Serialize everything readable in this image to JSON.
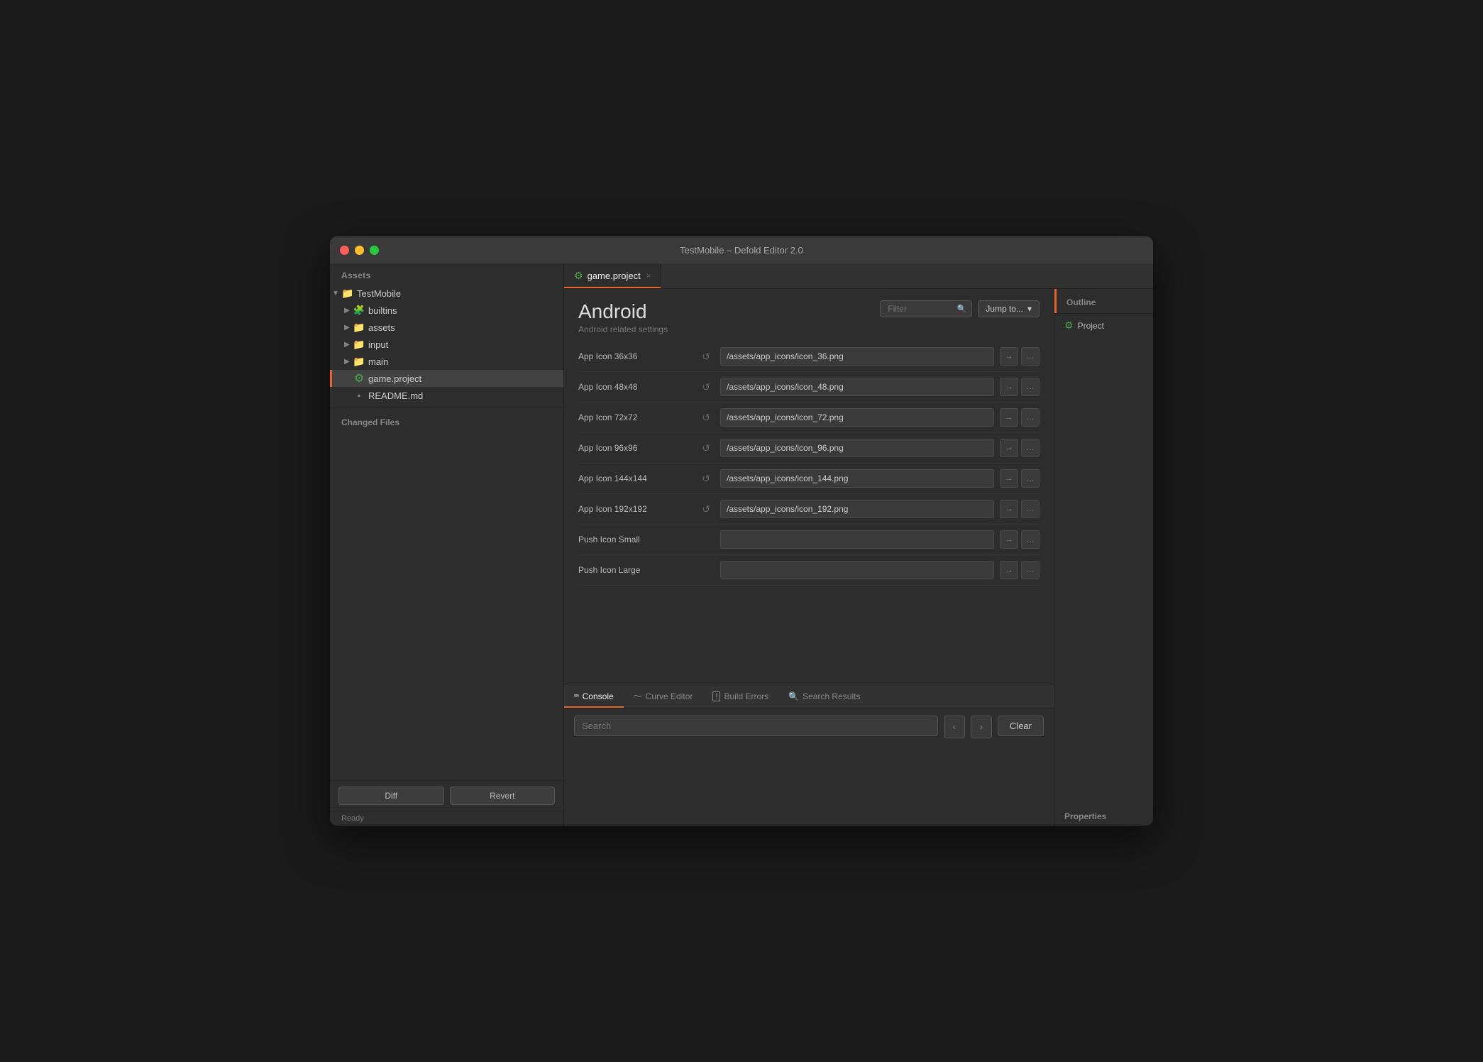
{
  "window": {
    "title": "TestMobile – Defold Editor 2.0"
  },
  "titlebar": {
    "title": "TestMobile – Defold Editor 2.0"
  },
  "sidebar": {
    "assets_label": "Assets",
    "changed_files_label": "Changed Files",
    "status": "Ready",
    "diff_btn": "Diff",
    "revert_btn": "Revert",
    "tree": [
      {
        "id": "testmobile",
        "label": "TestMobile",
        "indent": 0,
        "type": "folder",
        "expanded": true
      },
      {
        "id": "builtins",
        "label": "builtins",
        "indent": 1,
        "type": "folder-gear",
        "expanded": false
      },
      {
        "id": "assets",
        "label": "assets",
        "indent": 1,
        "type": "folder",
        "expanded": false
      },
      {
        "id": "input",
        "label": "input",
        "indent": 1,
        "type": "folder",
        "expanded": false
      },
      {
        "id": "main",
        "label": "main",
        "indent": 1,
        "type": "folder",
        "expanded": false
      },
      {
        "id": "game.project",
        "label": "game.project",
        "indent": 1,
        "type": "gear",
        "active": true
      },
      {
        "id": "readme",
        "label": "README.md",
        "indent": 1,
        "type": "file"
      }
    ]
  },
  "tabs": [
    {
      "id": "game-project",
      "label": "game.project",
      "closable": true,
      "active": true,
      "icon": "gear"
    }
  ],
  "editor": {
    "title": "Android",
    "subtitle": "Android related settings",
    "filter_placeholder": "Filter",
    "jump_to_label": "Jump to...",
    "settings": [
      {
        "id": "icon36",
        "label": "App Icon 36x36",
        "value": "/assets/app_icons/icon_36.png",
        "has_reset": true
      },
      {
        "id": "icon48",
        "label": "App Icon 48x48",
        "value": "/assets/app_icons/icon_48.png",
        "has_reset": true
      },
      {
        "id": "icon72",
        "label": "App Icon 72x72",
        "value": "/assets/app_icons/icon_72.png",
        "has_reset": true
      },
      {
        "id": "icon96",
        "label": "App Icon 96x96",
        "value": "/assets/app_icons/icon_96.png",
        "has_reset": true
      },
      {
        "id": "icon144",
        "label": "App Icon 144x144",
        "value": "/assets/app_icons/icon_144.png",
        "has_reset": true
      },
      {
        "id": "icon192",
        "label": "App Icon 192x192",
        "value": "/assets/app_icons/icon_192.png",
        "has_reset": true
      },
      {
        "id": "push_small",
        "label": "Push Icon Small",
        "value": "",
        "has_reset": false
      },
      {
        "id": "push_large",
        "label": "Push Icon Large",
        "value": "",
        "has_reset": false
      }
    ]
  },
  "bottom_panel": {
    "tabs": [
      {
        "id": "console",
        "label": "Console",
        "icon": "terminal",
        "active": true
      },
      {
        "id": "curve-editor",
        "label": "Curve Editor",
        "icon": "curve"
      },
      {
        "id": "build-errors",
        "label": "Build Errors",
        "icon": "warning"
      },
      {
        "id": "search-results",
        "label": "Search Results",
        "icon": "search"
      }
    ],
    "search_placeholder": "Search",
    "prev_label": "‹",
    "next_label": "›",
    "clear_label": "Clear"
  },
  "right_panel": {
    "outline_label": "Outline",
    "project_label": "Project",
    "properties_label": "Properties"
  },
  "icons": {
    "gear": "⚙",
    "folder": "▶",
    "file": "▪",
    "search": "⌕",
    "reset": "↺",
    "arrow_right": "→",
    "ellipsis": "…",
    "chevron_down": "▾",
    "terminal": ">_",
    "warning": "!",
    "close": "×",
    "prev": "‹",
    "next": "›"
  }
}
